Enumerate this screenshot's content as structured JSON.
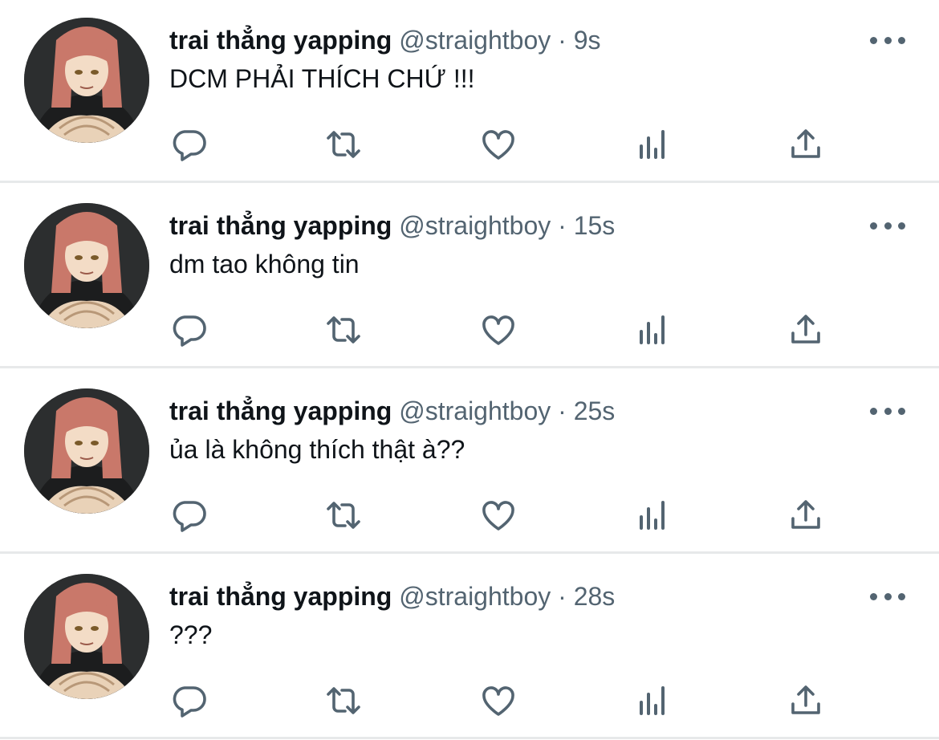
{
  "colors": {
    "text_primary": "#0f1419",
    "text_secondary": "#536471",
    "divider": "#e7e9ea",
    "icon": "#536471"
  },
  "icons": {
    "avatar": "profile-picture-red-hair-character",
    "more": "more-horizontal-icon",
    "reply": "reply-icon",
    "retweet": "retweet-icon",
    "like": "heart-icon",
    "views": "views-bar-chart-icon",
    "share": "share-upload-icon"
  },
  "tweets": [
    {
      "name": "trai thẳng yapping",
      "handle": "@straightboy",
      "separator": "·",
      "time": "9s",
      "text": "DCM PHẢI THÍCH CHỨ !!!"
    },
    {
      "name": "trai thẳng yapping",
      "handle": "@straightboy",
      "separator": "·",
      "time": "15s",
      "text": "dm tao không tin"
    },
    {
      "name": "trai thẳng yapping",
      "handle": "@straightboy",
      "separator": "·",
      "time": "25s",
      "text": "ủa là không thích thật à??"
    },
    {
      "name": "trai thẳng yapping",
      "handle": "@straightboy",
      "separator": "·",
      "time": "28s",
      "text": "???"
    }
  ]
}
